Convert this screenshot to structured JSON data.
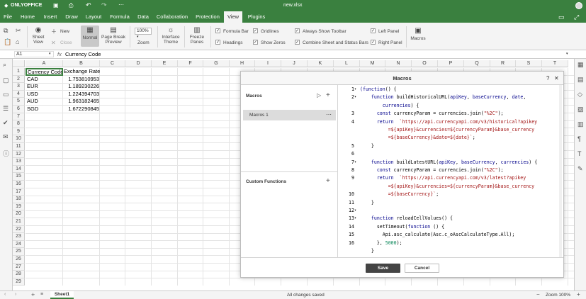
{
  "title": {
    "app": "ONLYOFFICE",
    "file": "new.xlsx"
  },
  "tabs": [
    "File",
    "Home",
    "Insert",
    "Draw",
    "Layout",
    "Formula",
    "Data",
    "Collaboration",
    "Protection",
    "View",
    "Plugins"
  ],
  "toolbar": {
    "sheet_view": "Sheet View",
    "new": "New",
    "close": "Close",
    "normal": "Normal",
    "page_break": "Page Break",
    "preview": "Preview",
    "zoom_value": "100%",
    "zoom": "Zoom",
    "interface": "Interface",
    "theme": "Theme",
    "freeze": "Freeze",
    "panes": "Panes",
    "checks": [
      "Formula Bar",
      "Gridlines",
      "Always Show Toolbar",
      "Left Panel",
      "Headings",
      "Show Zeros",
      "Combine Sheet and Status Bars",
      "Right Panel"
    ],
    "macros": "Macros"
  },
  "formula": {
    "cell_ref": "A1",
    "fx": "fx",
    "value": "Currency Code"
  },
  "columns": [
    "A",
    "B",
    "C",
    "D",
    "E",
    "F",
    "G",
    "H",
    "I",
    "J",
    "K",
    "L",
    "M",
    "N",
    "O",
    "P",
    "Q",
    "R",
    "S",
    "T"
  ],
  "rows": [
    "1",
    "2",
    "3",
    "4",
    "5",
    "6",
    "7",
    "8",
    "9",
    "10",
    "11",
    "12",
    "13",
    "14",
    "15",
    "16",
    "17",
    "18",
    "19",
    "20",
    "21",
    "22",
    "23",
    "24",
    "25",
    "26",
    "27",
    "28",
    "29"
  ],
  "cells": [
    [
      "Currency Code",
      "Exchange Rate"
    ],
    [
      "CAD",
      "1.753810953"
    ],
    [
      "EUR",
      "1.189230226"
    ],
    [
      "USD",
      "1.224394703"
    ],
    [
      "AUD",
      "1.963182465"
    ],
    [
      "SGD",
      "1.672290845"
    ]
  ],
  "dialog": {
    "title": "Macros",
    "help": "?",
    "close": "✕",
    "macros_label": "Macros",
    "macro_item": "Macros 1",
    "menu_dots": "⋯",
    "custom_functions": "Custom Functions",
    "save": "Save",
    "cancel": "Cancel",
    "line_numbers": [
      "1",
      "2",
      "",
      "3",
      "4",
      "",
      "",
      "5",
      "6",
      "7",
      "8",
      "9",
      "",
      "10",
      "11",
      "12",
      "13",
      "14",
      "15",
      "16"
    ],
    "fold_markers": [
      "▾",
      "▾",
      "",
      "",
      "",
      "",
      "",
      "",
      "",
      "▾",
      "",
      "",
      "",
      "",
      "",
      "▾",
      "▾",
      "",
      "",
      ""
    ]
  },
  "code_lines": [
    {
      "p": [
        [
          "k",
          "(function"
        ],
        [
          "",
          "() {"
        ]
      ]
    },
    {
      "p": [
        [
          "",
          "    "
        ],
        [
          "k",
          "function"
        ],
        [
          "",
          " buildHistoricalURL("
        ],
        [
          "k",
          "apiKey"
        ],
        [
          "",
          ", "
        ],
        [
          "k",
          "baseCurrency"
        ],
        [
          "",
          ", "
        ],
        [
          "k",
          "date"
        ],
        [
          "",
          ","
        ]
      ]
    },
    {
      "p": [
        [
          "",
          "        "
        ],
        [
          "k",
          "currencies"
        ],
        [
          "",
          ") {"
        ]
      ]
    },
    {
      "p": [
        [
          "",
          "      "
        ],
        [
          "k",
          "const"
        ],
        [
          "",
          " currencyParam = currencies.join("
        ],
        [
          "s",
          "\"%2C\""
        ],
        [
          "",
          ");"
        ]
      ]
    },
    {
      "p": [
        [
          "",
          "      "
        ],
        [
          "k",
          "return"
        ],
        [
          "",
          "  "
        ],
        [
          "s",
          "`https://api.currencyapi.com/v3/historical?apikey"
        ]
      ]
    },
    {
      "p": [
        [
          "s",
          "          =${apiKey}&currencies=${currencyParam}&base_currency"
        ]
      ]
    },
    {
      "p": [
        [
          "s",
          "          =${baseCurrency}&date=${date}`"
        ],
        [
          "",
          ";"
        ]
      ]
    },
    {
      "p": [
        [
          "",
          "    }"
        ]
      ]
    },
    {
      "p": [
        [
          "",
          ""
        ]
      ]
    },
    {
      "p": [
        [
          "",
          "    "
        ],
        [
          "k",
          "function"
        ],
        [
          "",
          " buildLatestURL("
        ],
        [
          "k",
          "apiKey"
        ],
        [
          "",
          ", "
        ],
        [
          "k",
          "baseCurrency"
        ],
        [
          "",
          ", "
        ],
        [
          "k",
          "currencies"
        ],
        [
          "",
          ") {"
        ]
      ]
    },
    {
      "p": [
        [
          "",
          "      "
        ],
        [
          "k",
          "const"
        ],
        [
          "",
          " currencyParam = currencies.join("
        ],
        [
          "s",
          "\"%2C\""
        ],
        [
          "",
          ");"
        ]
      ]
    },
    {
      "p": [
        [
          "",
          "      "
        ],
        [
          "k",
          "return"
        ],
        [
          "",
          "  "
        ],
        [
          "s",
          "`https://api.currencyapi.com/v3/latest?apikey"
        ]
      ]
    },
    {
      "p": [
        [
          "s",
          "          =${apiKey}&currencies=${currencyParam}&base_currency"
        ]
      ]
    },
    {
      "p": [
        [
          "s",
          "          =${baseCurrency}`"
        ],
        [
          "",
          ";"
        ]
      ]
    },
    {
      "p": [
        [
          "",
          "    }"
        ]
      ]
    },
    {
      "p": [
        [
          "",
          ""
        ]
      ]
    },
    {
      "p": [
        [
          "",
          "    "
        ],
        [
          "k",
          "function"
        ],
        [
          "",
          " reloadCellValues() {"
        ]
      ]
    },
    {
      "p": [
        [
          "",
          "      setTimeout("
        ],
        [
          "k",
          "function"
        ],
        [
          "",
          " () {"
        ]
      ]
    },
    {
      "p": [
        [
          "",
          "        Api.asc_calculate(Asc.c_oAscCalculateType.All);"
        ]
      ]
    },
    {
      "p": [
        [
          "",
          "      }, "
        ],
        [
          "n",
          "5000"
        ],
        [
          "",
          ");"
        ]
      ]
    },
    {
      "p": [
        [
          "",
          "    }"
        ]
      ]
    }
  ],
  "status": {
    "sheet": "Sheet1",
    "saved": "All changes saved",
    "zoom": "Zoom 100%"
  },
  "colors": {
    "brand": "#3a803f",
    "keyword": "#00008b",
    "string": "#a31515",
    "number": "#098658"
  }
}
